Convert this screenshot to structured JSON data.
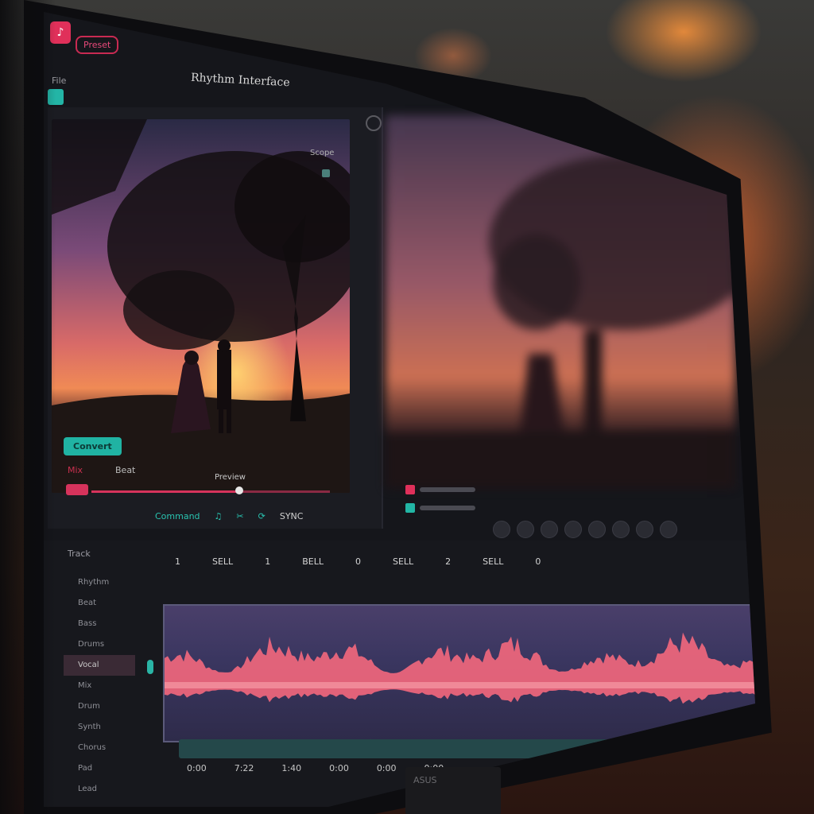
{
  "window": {
    "app_badge_label": "",
    "app_pill_label": "Preset",
    "title": "Rhythm Interface",
    "menu_label": "File"
  },
  "left_preview": {
    "corner_label": "Scope",
    "teal_button_label": "Convert",
    "red_label": "Mix",
    "gray_label": "Beat",
    "preview_label": "Preview",
    "slider_value": 0.62
  },
  "controls": {
    "command_label": "Command",
    "icon1": "music-note-icon",
    "icon2": "scissor-icon",
    "status_label": "SYNC"
  },
  "ruler": {
    "labels": [
      "1",
      "SELL",
      "1",
      "BELL",
      "0",
      "SELL",
      "2",
      "SELL",
      "0"
    ]
  },
  "side_list": {
    "title": "Track",
    "items": [
      "Rhythm",
      "Beat",
      "Bass",
      "Drums",
      "Vocal",
      "Mix",
      "Drum",
      "Synth",
      "Chorus",
      "Pad",
      "Lead"
    ],
    "active_index": 4
  },
  "bottom_times": [
    "0:00",
    "7:22",
    "1:40",
    "0:00",
    "0:00",
    "0:00"
  ],
  "stand_label": "ASUS",
  "colors": {
    "accent_red": "#d6335c",
    "accent_teal": "#22b6a5"
  }
}
